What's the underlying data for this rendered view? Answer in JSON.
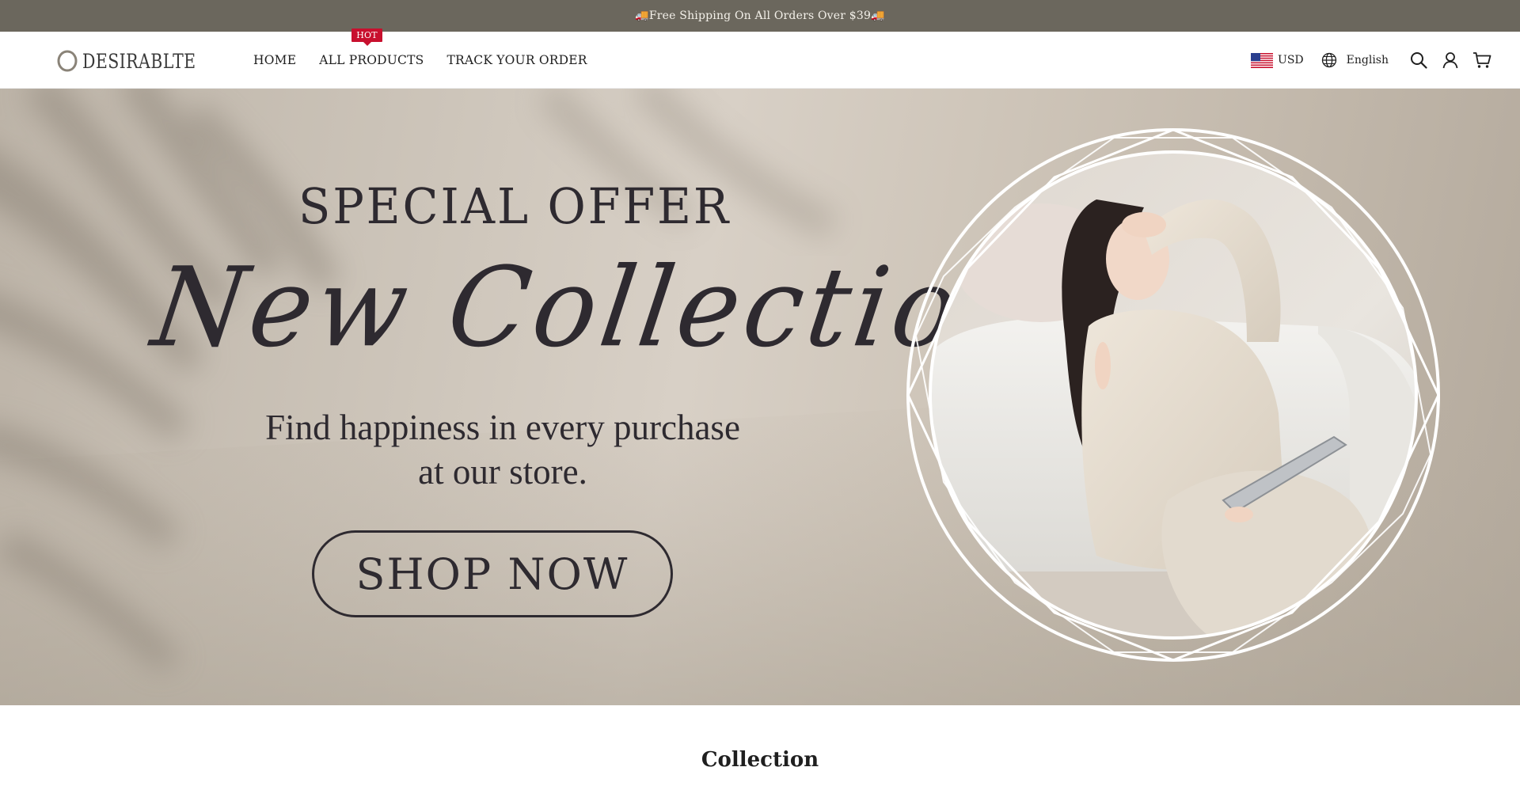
{
  "announcement": {
    "text": "🚚Free Shipping On All Orders Over $39🚚"
  },
  "header": {
    "logo_text": "DESIRABLTE",
    "nav": [
      {
        "label": "HOME"
      },
      {
        "label": "ALL PRODUCTS",
        "badge": "HOT"
      },
      {
        "label": "TRACK YOUR ORDER"
      }
    ],
    "currency": {
      "label": "USD",
      "flag_icon": "us-flag-icon"
    },
    "language": {
      "label": "English",
      "icon": "globe-icon"
    },
    "icons": [
      "search-icon",
      "account-icon",
      "cart-icon"
    ]
  },
  "hero": {
    "headline": "SPECIAL OFFER",
    "script_title": "New Collection",
    "tagline_line1": "Find happiness in every purchase",
    "tagline_line2": "at our store.",
    "cta_label": "SHOP NOW"
  },
  "collection": {
    "title": "Collection"
  },
  "colors": {
    "announcement_bg": "#6b675d",
    "hot_badge": "#c8102e",
    "hero_text": "#2e2a30"
  }
}
